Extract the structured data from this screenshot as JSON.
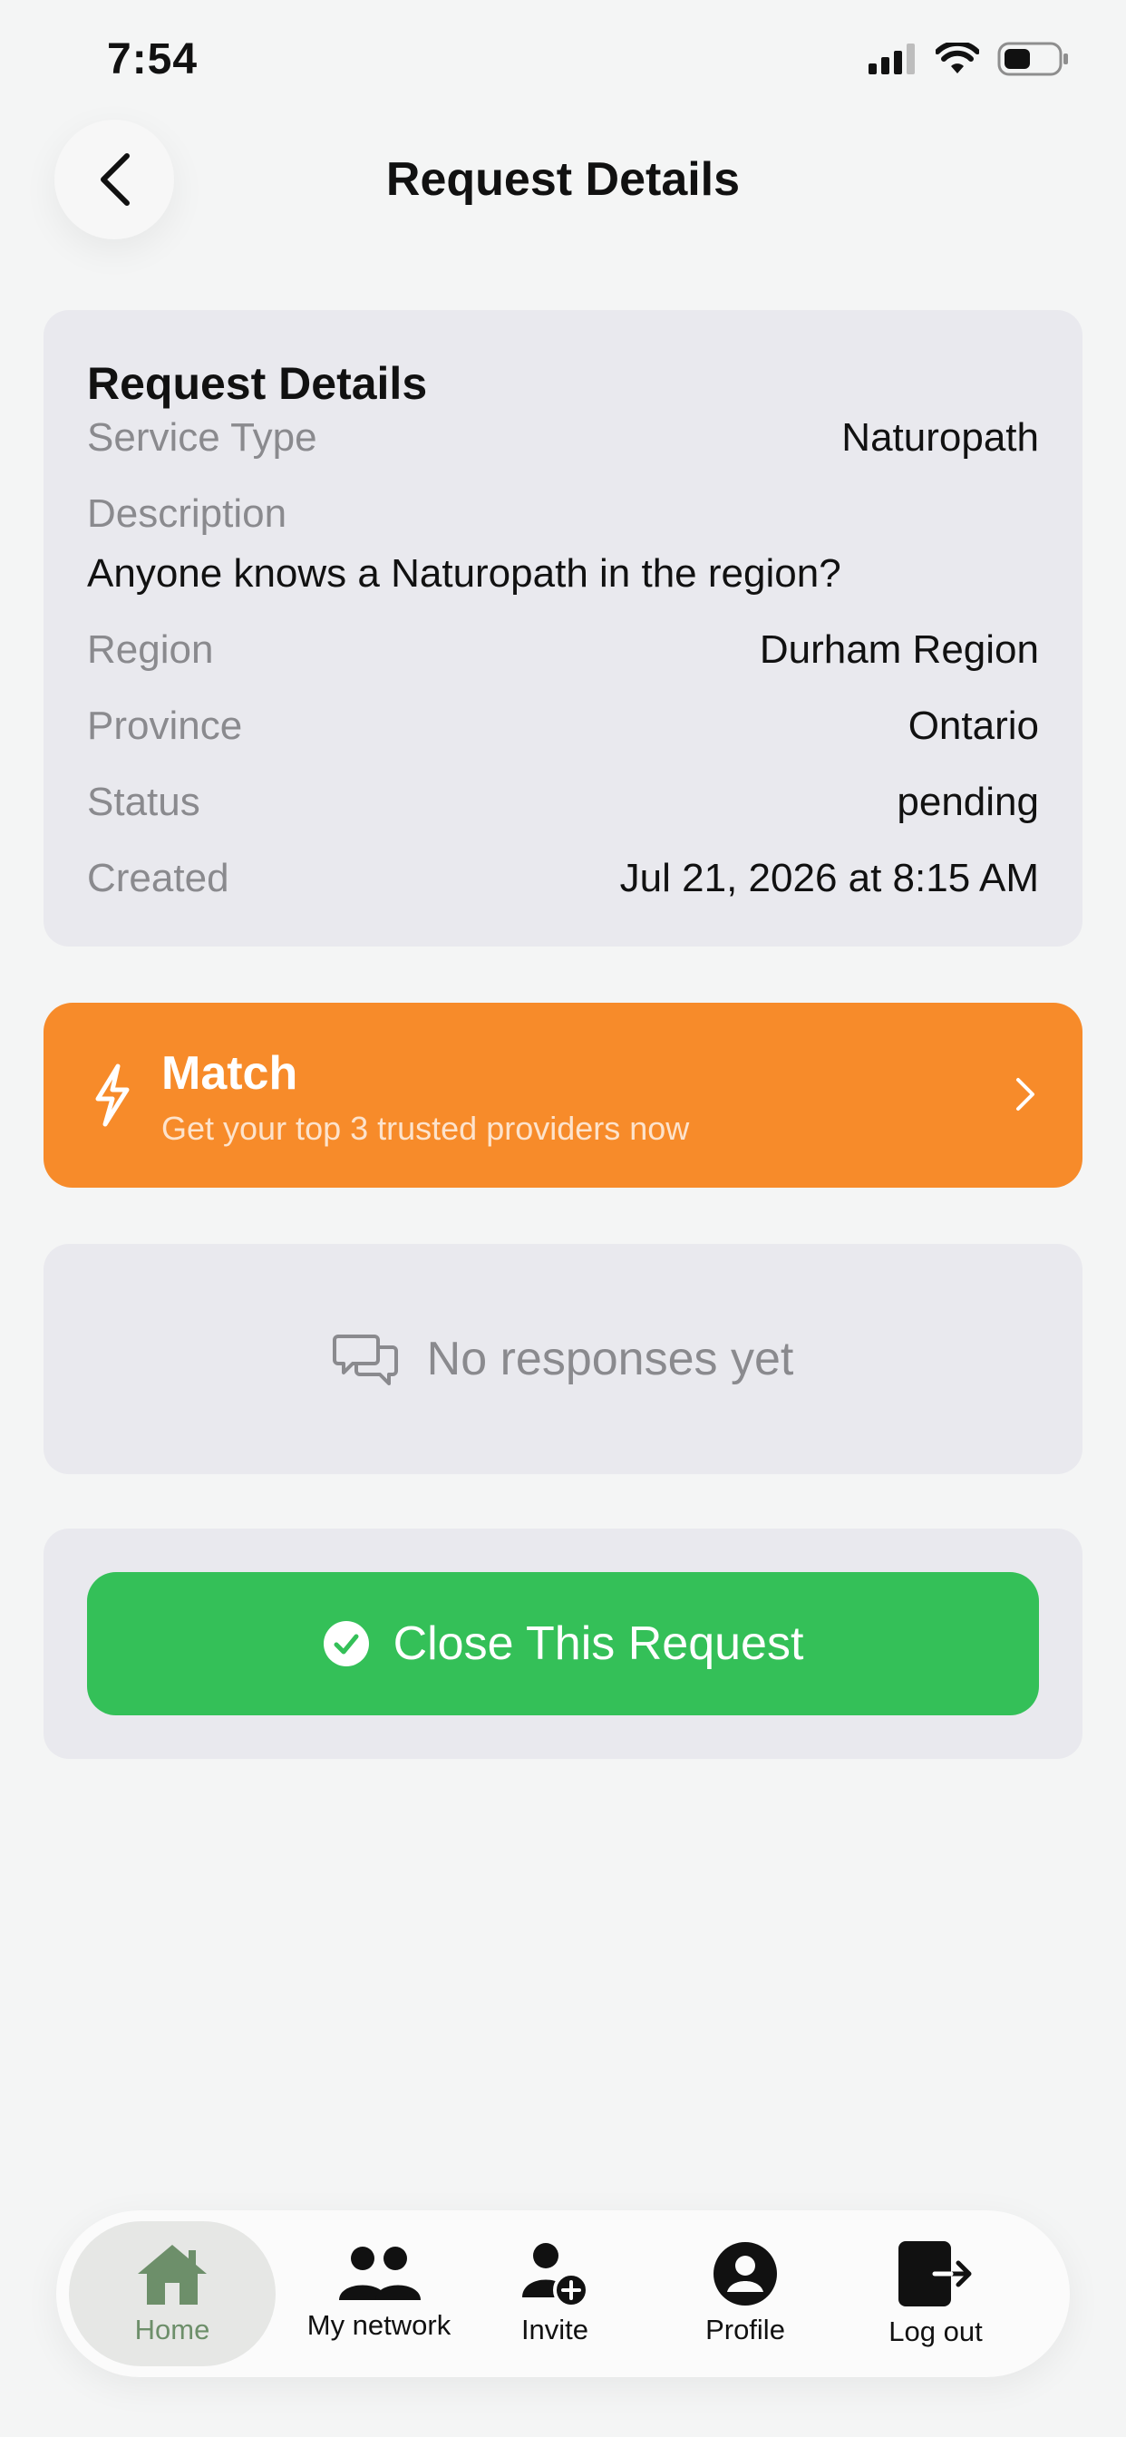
{
  "status_bar": {
    "time": "7:54"
  },
  "header": {
    "title": "Request Details",
    "back_icon": "chevron-left-icon"
  },
  "details": {
    "title": "Request Details",
    "service_type": {
      "label": "Service Type",
      "value": "Naturopath"
    },
    "description": {
      "label": "Description",
      "value": "Anyone knows a Naturopath in the region?"
    },
    "region": {
      "label": "Region",
      "value": "Durham Region"
    },
    "province": {
      "label": "Province",
      "value": "Ontario"
    },
    "status": {
      "label": "Status",
      "value": "pending"
    },
    "created": {
      "label": "Created",
      "value": "Jul 21, 2026 at 8:15 AM"
    }
  },
  "match": {
    "title": "Match",
    "subtitle": "Get your top 3 trusted providers now",
    "color": "#f78b2a"
  },
  "responses": {
    "empty_text": "No responses yet"
  },
  "close_request": {
    "label": "Close This Request",
    "color": "#34c058"
  },
  "tabbar": {
    "active_color": "#6d8f6a",
    "items": [
      {
        "label": "Home",
        "icon": "home-icon",
        "active": true
      },
      {
        "label": "My network",
        "icon": "people-icon",
        "active": false
      },
      {
        "label": "Invite",
        "icon": "add-user-icon",
        "active": false
      },
      {
        "label": "Profile",
        "icon": "profile-icon",
        "active": false
      },
      {
        "label": "Log out",
        "icon": "logout-icon",
        "active": false
      }
    ]
  }
}
